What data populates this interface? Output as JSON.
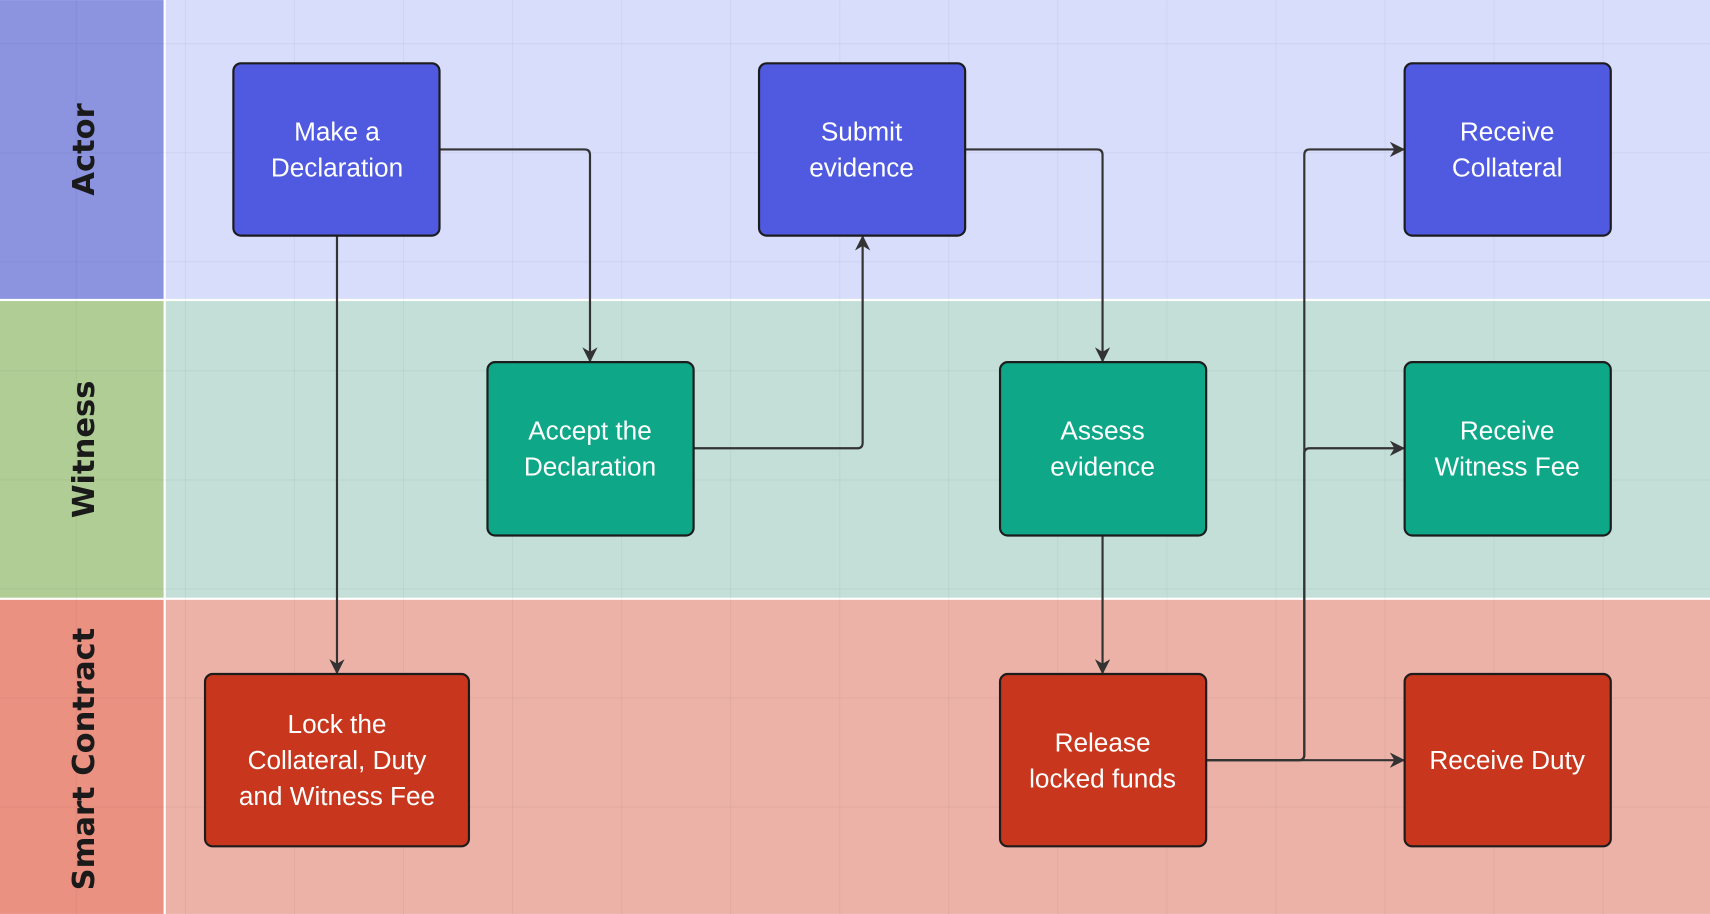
{
  "colors": {
    "actor_node": "#4f5ae0",
    "witness_node": "#0ea888",
    "contract_node": "#c8371d",
    "actor_lane": "#d8ddfc",
    "actor_label_bg": "#8c94e0",
    "witness_lane": "#c3dfd8",
    "witness_label_bg": "#b1cd96",
    "contract_lane": "#ecb2a7",
    "contract_label_bg": "#ea9182"
  },
  "lanes": {
    "actor": "Actor",
    "witness": "Witness",
    "contract": "Smart Contract"
  },
  "nodes": {
    "make_declaration": [
      "Make a",
      "Declaration"
    ],
    "submit_evidence": [
      "Submit",
      "evidence"
    ],
    "receive_collateral": [
      "Receive",
      "Collateral"
    ],
    "accept_declaration": [
      "Accept the",
      "Declaration"
    ],
    "assess_evidence": [
      "Assess",
      "evidence"
    ],
    "receive_witness_fee": [
      "Receive",
      "Witness Fee"
    ],
    "lock_collateral": [
      "Lock the",
      "Collateral, Duty",
      "and Witness Fee"
    ],
    "release_funds": [
      "Release",
      "locked funds"
    ],
    "receive_duty": [
      "Receive Duty"
    ]
  },
  "edges": [
    [
      "make_declaration",
      "accept_declaration"
    ],
    [
      "make_declaration",
      "lock_collateral"
    ],
    [
      "accept_declaration",
      "submit_evidence"
    ],
    [
      "submit_evidence",
      "assess_evidence"
    ],
    [
      "assess_evidence",
      "release_funds"
    ],
    [
      "release_funds",
      "receive_duty"
    ],
    [
      "release_funds",
      "receive_witness_fee"
    ],
    [
      "release_funds",
      "receive_collateral"
    ]
  ]
}
